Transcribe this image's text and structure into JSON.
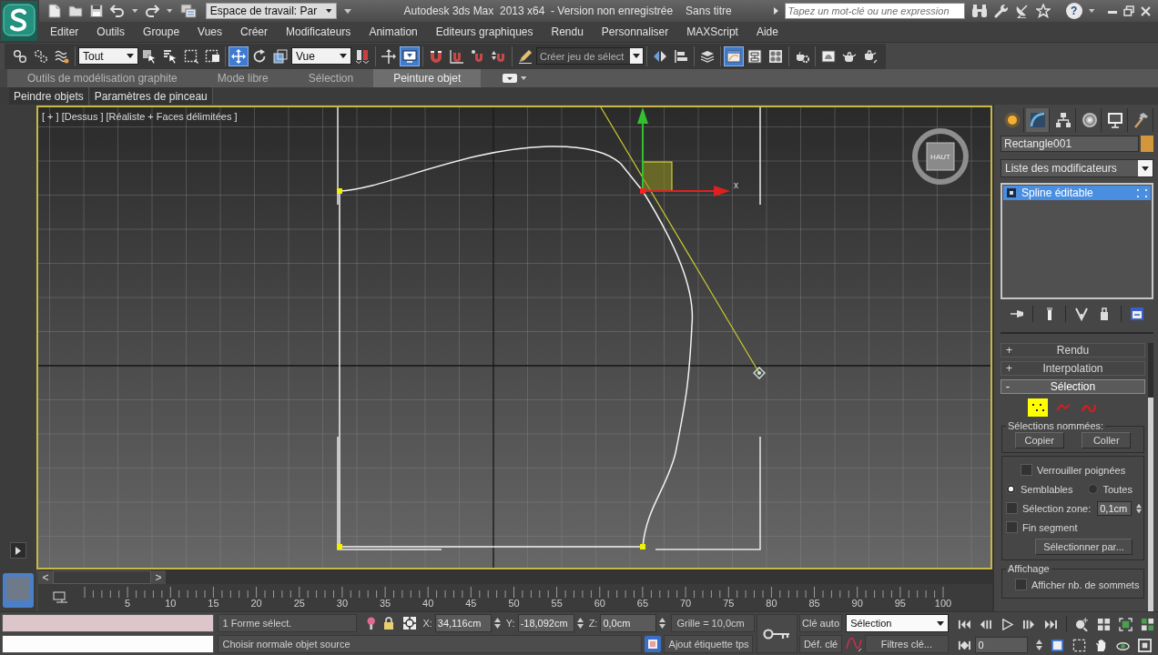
{
  "title_bar": {
    "workspace": "Espace de travail: Par",
    "title": "Autodesk 3ds Max  2013 x64  - Version non enregistrée",
    "file": "Sans titre",
    "search": {
      "placeholder": "Tapez un mot-clé ou une expression"
    },
    "help": "?"
  },
  "menu": [
    "Editer",
    "Outils",
    "Groupe",
    "Vues",
    "Créer",
    "Modificateurs",
    "Animation",
    "Editeurs graphiques",
    "Rendu",
    "Personnaliser",
    "MAXScript",
    "Aide"
  ],
  "toolbar": {
    "groups": [
      [
        {
          "kind": "button",
          "on": false
        },
        {
          "kind": "button",
          "on": false
        },
        {
          "kind": "button",
          "on": false
        }
      ],
      [
        {
          "kind": "dropdown",
          "value": "Tout"
        },
        {
          "kind": "button",
          "on": false
        },
        {
          "kind": "button",
          "on": false
        },
        {
          "kind": "button",
          "on": false
        },
        {
          "kind": "button",
          "on": false
        }
      ],
      [
        {
          "kind": "button",
          "on": true
        },
        {
          "kind": "button",
          "on": false
        },
        {
          "kind": "button",
          "on": false
        },
        {
          "kind": "dropdown",
          "value": "Vue"
        },
        {
          "kind": "button",
          "on": false
        }
      ],
      [
        {
          "kind": "button",
          "on": false
        },
        {
          "kind": "button",
          "on": true
        }
      ],
      [
        {
          "kind": "button",
          "on": false
        },
        {
          "kind": "button",
          "on": false
        },
        {
          "kind": "button",
          "on": false
        },
        {
          "kind": "button",
          "on": false
        }
      ],
      [
        {
          "kind": "button",
          "on": false
        },
        {
          "kind": "combo",
          "value": "Créer jeu de sélect"
        }
      ],
      [
        {
          "kind": "button",
          "on": false
        },
        {
          "kind": "button",
          "on": false
        }
      ],
      [
        {
          "kind": "button",
          "on": false
        }
      ],
      [
        {
          "kind": "button",
          "on": true
        },
        {
          "kind": "button",
          "on": false
        },
        {
          "kind": "button",
          "on": false
        }
      ],
      [
        {
          "kind": "button",
          "on": false
        }
      ],
      [
        {
          "kind": "button",
          "on": false
        },
        {
          "kind": "button",
          "on": false
        },
        {
          "kind": "button",
          "on": false
        }
      ]
    ]
  },
  "ribbon": {
    "tabs": [
      {
        "label": "Outils de modélisation graphite",
        "selected": false
      },
      {
        "label": "Mode libre",
        "selected": false
      },
      {
        "label": "Sélection",
        "selected": false
      },
      {
        "label": "Peinture objet",
        "selected": true
      }
    ],
    "panels": [
      "Peindre objets",
      "Paramètres de pinceau"
    ]
  },
  "viewport": {
    "active": true,
    "labels": [
      "[ + ]",
      "[Dessus ]",
      "[Réaliste + Faces délimitées ]"
    ],
    "viewcube_label": "HAUT",
    "gizmo_axis": "x"
  },
  "time_slider": {
    "prev": "<",
    "next": ">",
    "level": 0
  },
  "track_bar": {
    "ticks": [
      "5",
      "10",
      "15",
      "20",
      "25",
      "30",
      "35",
      "40",
      "45",
      "50",
      "55",
      "60",
      "65",
      "70",
      "75",
      "80",
      "85",
      "90",
      "95",
      "100"
    ]
  },
  "command_panel": {
    "tabs": [
      {
        "selected": false
      },
      {
        "selected": true
      },
      {
        "selected": false
      },
      {
        "selected": false
      },
      {
        "selected": false
      },
      {
        "selected": false
      }
    ],
    "object_name": "Rectangle001",
    "modifier_list": "Liste des modificateurs",
    "stack": [
      {
        "label": "Spline éditable",
        "selected": true
      }
    ],
    "rollouts": [
      {
        "sign": "+",
        "title": "Rendu",
        "expanded": false
      },
      {
        "sign": "+",
        "title": "Interpolation",
        "expanded": false
      },
      {
        "sign": "-",
        "title": "Sélection",
        "expanded": true,
        "body": {
          "levels": [
            {
              "selected": true
            },
            {
              "selected": false
            },
            {
              "selected": false
            }
          ],
          "named_title": "Sélections nommées:",
          "named_buttons": [
            "Copier",
            "Coller"
          ],
          "lock_handles": {
            "label": "Verrouiller poignées",
            "checked": false
          },
          "handle_mode": [
            {
              "label": "Semblables",
              "selected": true
            },
            {
              "label": "Toutes",
              "selected": false
            }
          ],
          "area_selection": {
            "label": "Sélection zone:",
            "checked": false,
            "value": "0,1cm"
          },
          "segment_end": {
            "label": "Fin segment",
            "checked": false
          },
          "select_by": "Sélectionner par...",
          "display_title": "Affichage",
          "show_vertex_numbers": {
            "label": "Afficher nb. de sommets",
            "checked": false
          }
        }
      }
    ]
  },
  "status": {
    "selection_count": "1 Forme sélect.",
    "coords": [
      {
        "axis": "X:",
        "value": "34,116cm"
      },
      {
        "axis": "Y:",
        "value": "-18,092cm"
      },
      {
        "axis": "Z:",
        "value": "0,0cm"
      }
    ],
    "grid": "Grille = 10,0cm",
    "prompt": "Choisir normale objet source",
    "time_tag": "Ajout étiquette tps",
    "auto_key": {
      "label": "Clé auto",
      "on": false
    },
    "set_key": "Déf. clé",
    "key_filter": "Sélection",
    "key_filters": "Filtres clé...",
    "frame": "0"
  }
}
